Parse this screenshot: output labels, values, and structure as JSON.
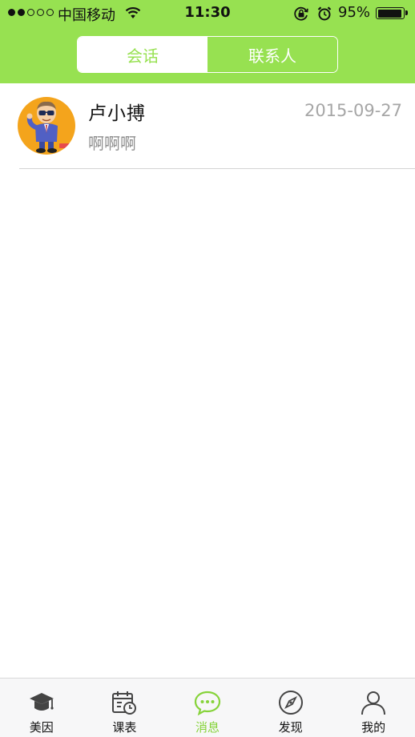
{
  "status_bar": {
    "carrier": "中国移动",
    "time": "11:30",
    "battery_percent": "95%",
    "battery_level": 0.95
  },
  "segmented": {
    "tabs": [
      {
        "label": "会话",
        "active": true
      },
      {
        "label": "联系人",
        "active": false
      }
    ]
  },
  "conversations": [
    {
      "name": "卢小搏",
      "time": "2015-09-27",
      "preview": "啊啊啊",
      "avatar_icon": "cartoon-man-avatar"
    }
  ],
  "tab_bar": {
    "items": [
      {
        "label": "美因",
        "icon": "graduation-cap-icon",
        "active": false
      },
      {
        "label": "课表",
        "icon": "calendar-clock-icon",
        "active": false
      },
      {
        "label": "消息",
        "icon": "chat-bubble-icon",
        "active": true
      },
      {
        "label": "发现",
        "icon": "compass-icon",
        "active": false
      },
      {
        "label": "我的",
        "icon": "person-icon",
        "active": false
      }
    ]
  },
  "colors": {
    "brand_green": "#97e151",
    "active_tab": "#86d33a",
    "avatar_bg": "#f4a41c"
  }
}
